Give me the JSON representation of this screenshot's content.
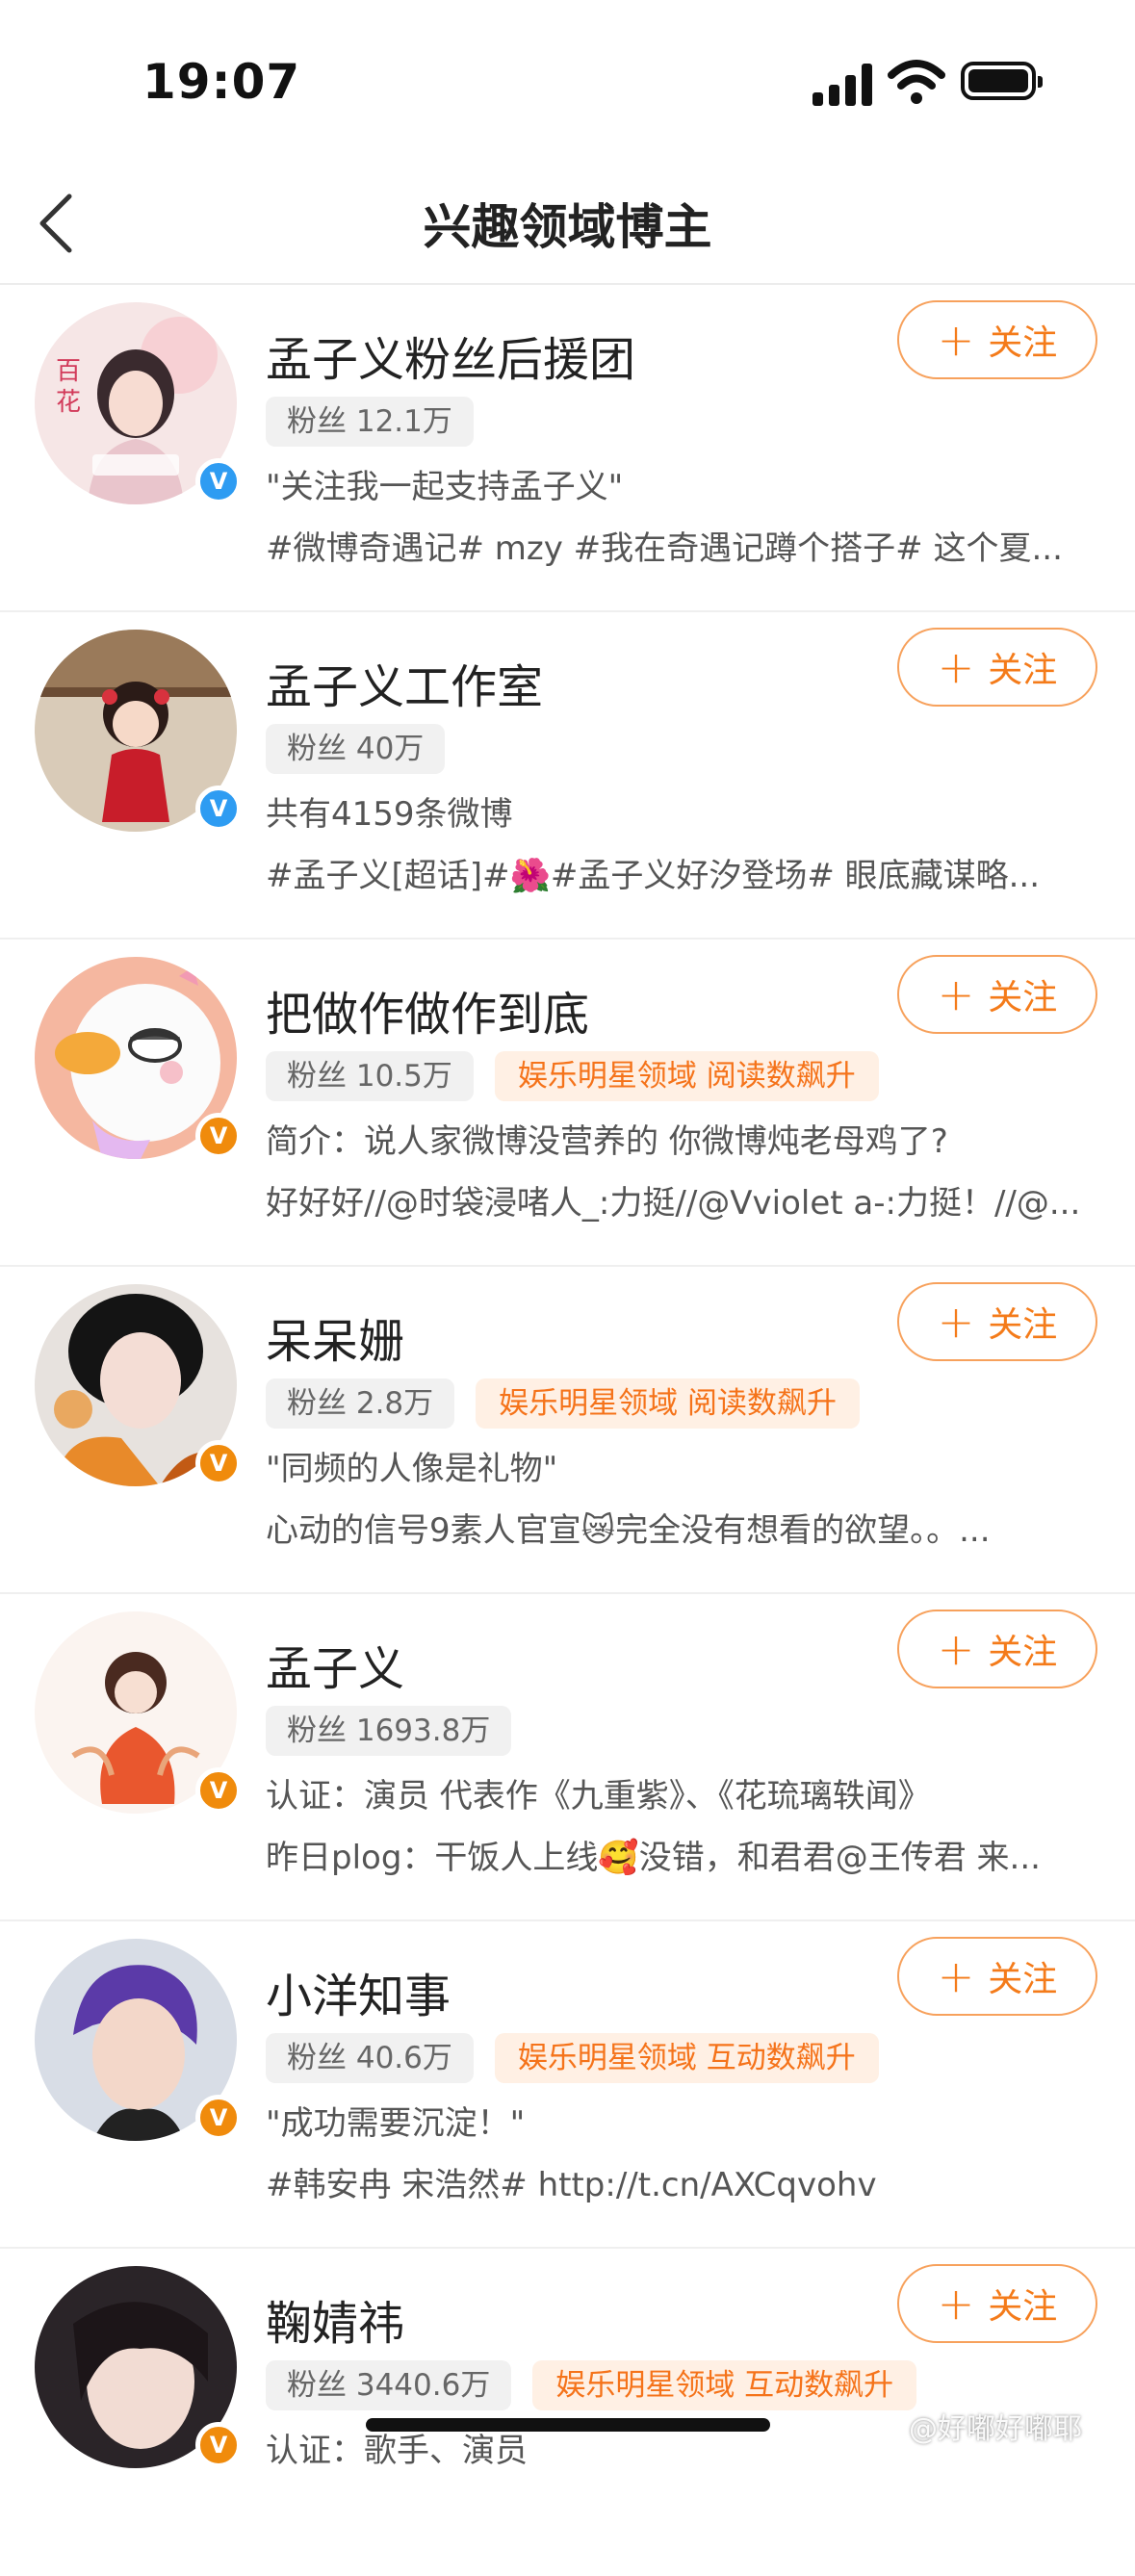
{
  "status_bar": {
    "time": "19:07"
  },
  "nav": {
    "title": "兴趣领域博主",
    "back_icon": "chevron-left-icon"
  },
  "follow_label": "关注",
  "bloggers": [
    {
      "name": "孟子义粉丝后援团",
      "fans": "粉丝 12.1万",
      "tag": "",
      "desc": "\"关注我一起支持孟子义\"",
      "latest": "#微博奇遇记# mzy #我在奇遇记蹲个搭子# 这个夏...",
      "badge": "blue",
      "badge_text": "V"
    },
    {
      "name": "孟子义工作室",
      "fans": "粉丝 40万",
      "tag": "",
      "desc": "共有4159条微博",
      "latest": "#孟子义[超话]#🌺#孟子义好汐登场# 眼底藏谋略...",
      "badge": "blue",
      "badge_text": "V"
    },
    {
      "name": "把做作做作到底",
      "fans": "粉丝 10.5万",
      "tag": "娱乐明星领域 阅读数飙升",
      "desc": "简介：说人家微博没营养的 你微博炖老母鸡了?",
      "latest": "好好好//@时袋浸啫人_:力挺//@Vviolet a-:力挺！//@...",
      "badge": "orange",
      "badge_text": "V"
    },
    {
      "name": "呆呆姗",
      "fans": "粉丝 2.8万",
      "tag": "娱乐明星领域 阅读数飙升",
      "desc": "\"同频的人像是礼物\"",
      "latest": "心动的信号9素人官宣😿完全没有想看的欲望。。...",
      "badge": "orange",
      "badge_text": "V"
    },
    {
      "name": "孟子义",
      "fans": "粉丝 1693.8万",
      "tag": "",
      "desc": "认证：演员 代表作《九重紫》、《花琉璃轶闻》",
      "latest": "昨日plog：干饭人上线🥰没错，和君君@王传君 来...",
      "badge": "orange",
      "badge_text": "V"
    },
    {
      "name": "小洋知事",
      "fans": "粉丝 40.6万",
      "tag": "娱乐明星领域 互动数飙升",
      "desc": "\"成功需要沉淀！\"",
      "latest": "#韩安冉 宋浩然# http://t.cn/AXCqvohv",
      "badge": "orange",
      "badge_text": "V"
    },
    {
      "name": "鞠婧祎",
      "fans": "粉丝 3440.6万",
      "tag": "娱乐明星领域 互动数飙升",
      "desc": "认证：歌手、演员",
      "latest": "",
      "badge": "orange",
      "badge_text": "V"
    }
  ],
  "watermark": "@好嘟好嘟耶"
}
